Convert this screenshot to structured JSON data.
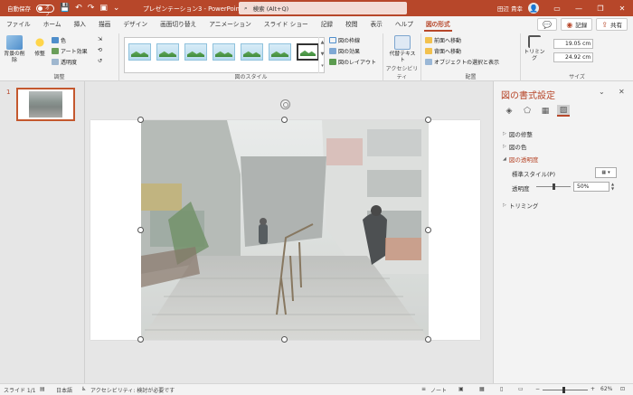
{
  "titlebar": {
    "autosave_label": "自動保存",
    "autosave_state": "オフ",
    "doc_title": "プレゼンテーション3 - PowerPoint",
    "search_placeholder": "検索 (Alt+Q)",
    "user_name": "田辺 貴幸"
  },
  "tabs": [
    "ファイル",
    "ホーム",
    "挿入",
    "描画",
    "デザイン",
    "画面切り替え",
    "アニメーション",
    "スライド ショー",
    "記録",
    "校閲",
    "表示",
    "ヘルプ",
    "図の形式"
  ],
  "tabs_right": {
    "record": "記録",
    "share": "共有"
  },
  "ribbon": {
    "remove_bg": "背景の削除",
    "corrections": "修整",
    "color": "色",
    "artistic": "アート効果",
    "transparency": "透明度",
    "group_adjust": "調整",
    "group_styles": "図のスタイル",
    "border": "図の枠線",
    "effects": "図の効果",
    "layout": "図のレイアウト",
    "alt_text": "代替テキスト",
    "group_accessibility": "アクセシビリティ",
    "bring_forward": "前面へ移動",
    "send_backward": "背面へ移動",
    "selection_pane": "オブジェクトの選択と表示",
    "group_arrange": "配置",
    "crop": "トリミング",
    "height": "19.05 cm",
    "width": "24.92 cm",
    "group_size": "サイズ"
  },
  "slides_panel": {
    "slide_number": "1"
  },
  "format_pane": {
    "title": "図の書式設定",
    "sections": {
      "corrections": "図の修整",
      "color": "図の色",
      "transparency": "図の透明度",
      "crop": "トリミング"
    },
    "preset_label": "標準スタイル(P)",
    "transparency_label": "透明度",
    "transparency_value": "50%"
  },
  "statusbar": {
    "slide_info": "スライド 1/1",
    "language": "日本語",
    "accessibility": "アクセシビリティ: 検討が必要です",
    "notes": "ノート",
    "zoom": "62%"
  },
  "colors": {
    "accent": "#b7472a",
    "accent_light": "#f3dcd6"
  }
}
